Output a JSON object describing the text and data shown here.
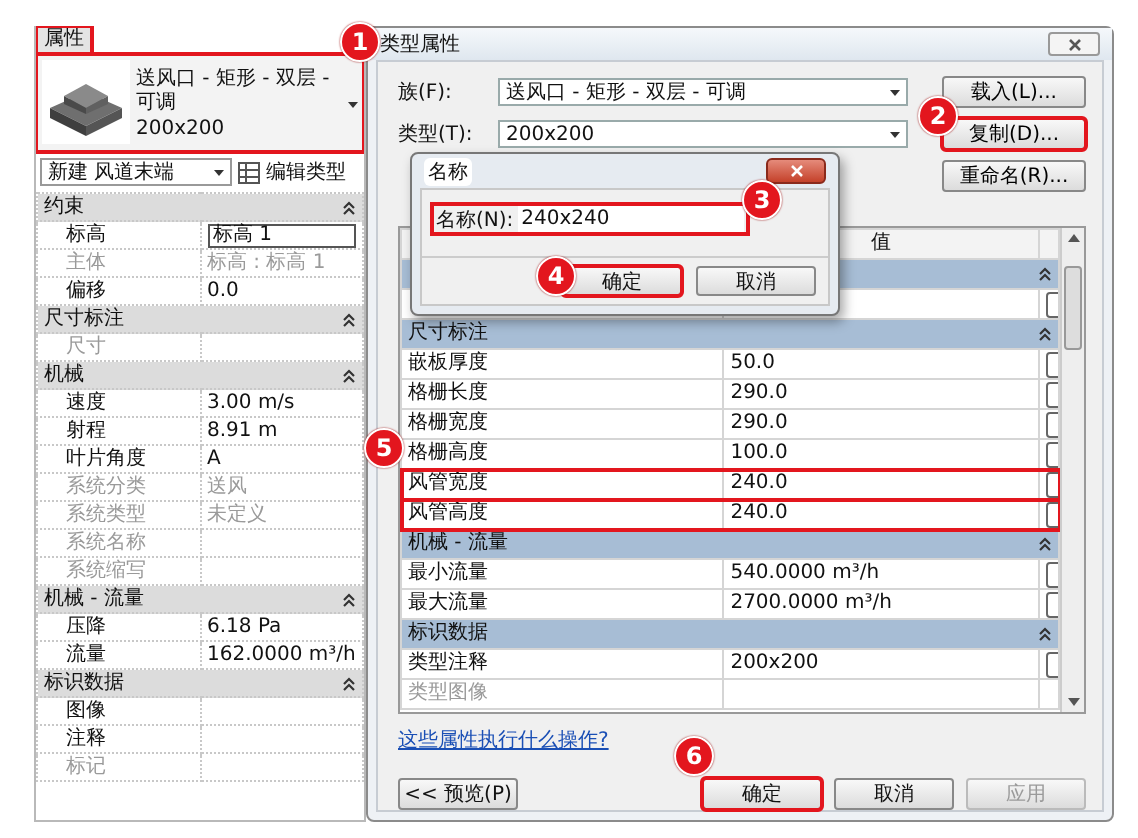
{
  "properties_panel": {
    "title": "属性",
    "title_highlighted": true,
    "preview_highlighted": true,
    "family": "送风口 - 矩形 - 双层 - 可调",
    "type": "200x200",
    "instance_filter": "新建 风道末端",
    "edit_type_button": "编辑类型",
    "groups": [
      {
        "title": "约束",
        "rows": [
          {
            "label": "标高",
            "value": "标高 1",
            "disabled": false,
            "selected": true
          },
          {
            "label": "主体",
            "value": "标高 : 标高 1",
            "disabled": true,
            "selected": false
          },
          {
            "label": "偏移",
            "value": "0.0",
            "disabled": false,
            "selected": false
          }
        ]
      },
      {
        "title": "尺寸标注",
        "rows": [
          {
            "label": "尺寸",
            "disabled": true,
            "selected": false
          }
        ]
      },
      {
        "title": "机械",
        "rows": [
          {
            "label": "速度",
            "value": "3.00 m/s",
            "disabled": false,
            "selected": false
          },
          {
            "label": "射程",
            "value": "8.91 m",
            "disabled": false,
            "selected": false
          },
          {
            "label": "叶片角度",
            "value": "A",
            "disabled": false,
            "selected": false
          },
          {
            "label": "系统分类",
            "value": "送风",
            "disabled": true,
            "selected": false
          },
          {
            "label": "系统类型",
            "value": "未定义",
            "disabled": true,
            "selected": false
          },
          {
            "label": "系统名称",
            "disabled": true,
            "selected": false
          },
          {
            "label": "系统缩写",
            "disabled": true,
            "selected": false
          }
        ]
      },
      {
        "title": "机械 - 流量",
        "rows": [
          {
            "label": "压降",
            "value": "6.18 Pa",
            "disabled": false,
            "selected": false
          },
          {
            "label": "流量",
            "value": "162.0000 m³/h",
            "disabled": false,
            "selected": false
          }
        ]
      },
      {
        "title": "标识数据",
        "rows": [
          {
            "label": "图像",
            "disabled": false,
            "selected": false
          },
          {
            "label": "注释",
            "disabled": false,
            "selected": false
          },
          {
            "label": "标记",
            "disabled": true,
            "selected": false
          }
        ]
      }
    ]
  },
  "type_dialog": {
    "title": "类型属性",
    "family_label": "族(F):",
    "family": "送风口 - 矩形 - 双层 - 可调",
    "type_label": "类型(T):",
    "type": "200x200",
    "side_buttons": [
      {
        "label": "载入(L)...",
        "highlighted": false
      },
      {
        "label": "复制(D)...",
        "highlighted": true
      },
      {
        "label": "重命名(R)...",
        "highlighted": false
      }
    ],
    "value_header": "值",
    "groups": [
      {
        "title": "尺寸标注",
        "rows": [
          {
            "label": "嵌板厚度",
            "value": "50.0",
            "disabled": false,
            "highlighted": false
          },
          {
            "label": "格栅长度",
            "value": "290.0",
            "disabled": false,
            "highlighted": false
          },
          {
            "label": "格栅宽度",
            "value": "290.0",
            "disabled": false,
            "highlighted": false
          },
          {
            "label": "格栅高度",
            "value": "100.0",
            "disabled": false,
            "highlighted": false
          },
          {
            "label": "风管宽度",
            "value": "240.0",
            "disabled": false,
            "highlighted": true
          },
          {
            "label": "风管高度",
            "value": "240.0",
            "disabled": false,
            "highlighted": true
          }
        ]
      },
      {
        "title": "机械 - 流量",
        "rows": [
          {
            "label": "最小流量",
            "value": "540.0000 m³/h",
            "disabled": false,
            "highlighted": false
          },
          {
            "label": "最大流量",
            "value": "2700.0000 m³/h",
            "disabled": false,
            "highlighted": false
          }
        ]
      },
      {
        "title": "标识数据",
        "rows": [
          {
            "label": "类型注释",
            "value": "200x200",
            "disabled": false,
            "highlighted": false
          },
          {
            "label": "类型图像",
            "disabled": true,
            "highlighted": false
          }
        ]
      }
    ],
    "help_link": "这些属性执行什么操作?",
    "preview_button": "<< 预览(P)",
    "footer_buttons": [
      {
        "label": "确定",
        "disabled": false,
        "highlighted": true
      },
      {
        "label": "取消",
        "disabled": false,
        "highlighted": false
      },
      {
        "label": "应用",
        "disabled": true,
        "highlighted": false
      }
    ]
  },
  "name_dialog": {
    "title": "名称",
    "field_label": "名称(N):",
    "value": "240x240",
    "field_highlighted": true,
    "buttons": [
      {
        "label": "确定",
        "highlighted": true
      },
      {
        "label": "取消",
        "highlighted": false
      }
    ]
  },
  "step_markers": [
    "1",
    "2",
    "3",
    "4",
    "5",
    "6"
  ]
}
